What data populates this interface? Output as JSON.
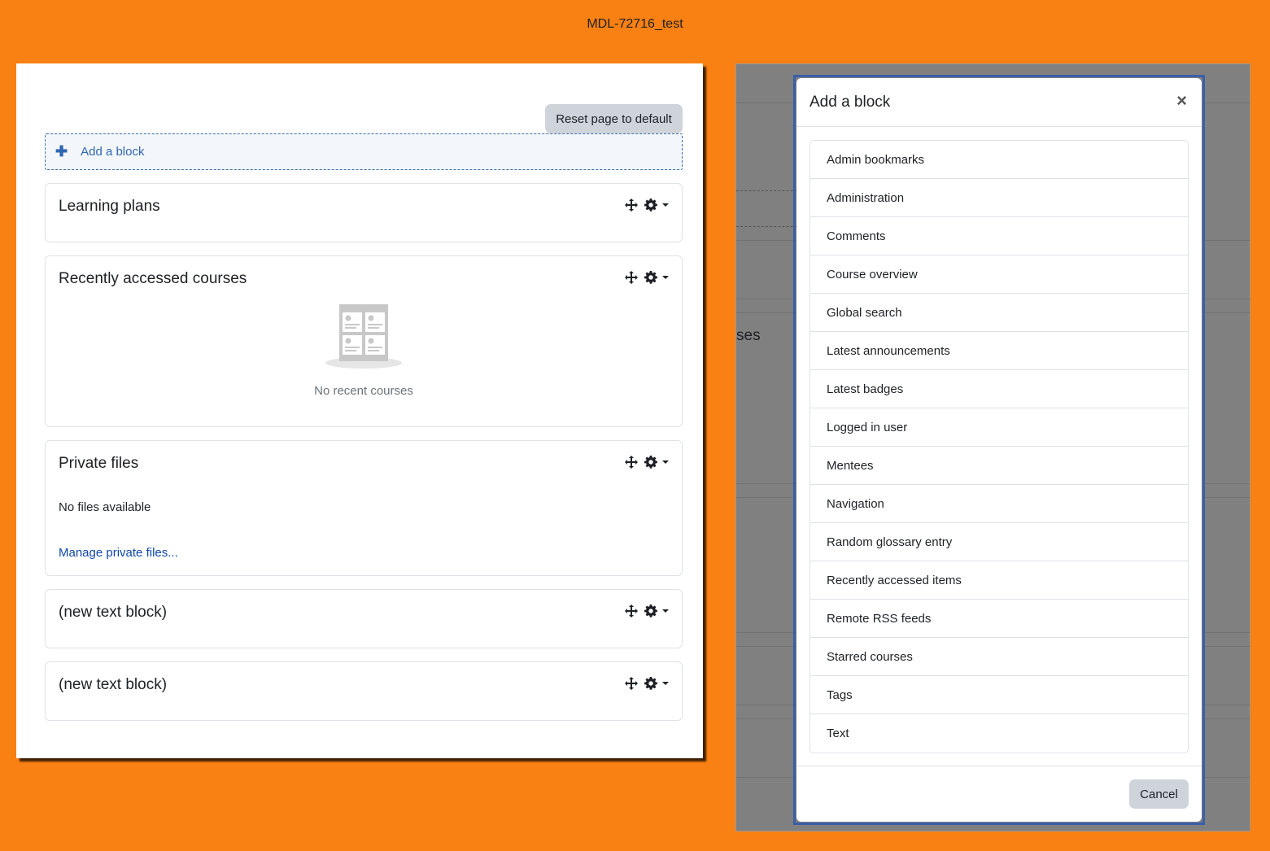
{
  "page": {
    "title": "MDL-72716_test"
  },
  "left": {
    "reset_label": "Reset page to default",
    "add_block": {
      "icon": "plus-icon",
      "label": "Add a block"
    },
    "blocks": [
      {
        "title": "Learning plans"
      },
      {
        "title": "Recently accessed courses",
        "empty_text": "No recent courses"
      },
      {
        "title": "Private files",
        "text": "No files available",
        "link": "Manage private files..."
      },
      {
        "title": "(new text block)"
      },
      {
        "title": "(new text block)"
      }
    ]
  },
  "background_page": {
    "partial_text": "ses"
  },
  "modal": {
    "title": "Add a block",
    "close_icon": "close-icon",
    "items": [
      "Admin bookmarks",
      "Administration",
      "Comments",
      "Course overview",
      "Global search",
      "Latest announcements",
      "Latest badges",
      "Logged in user",
      "Mentees",
      "Navigation",
      "Random glossary entry",
      "Recently accessed items",
      "Remote RSS feeds",
      "Starred courses",
      "Tags",
      "Text"
    ],
    "cancel_label": "Cancel"
  },
  "colors": {
    "background": "#f98012",
    "link": "#0f47ad",
    "modal_border": "#3b5ea8"
  }
}
